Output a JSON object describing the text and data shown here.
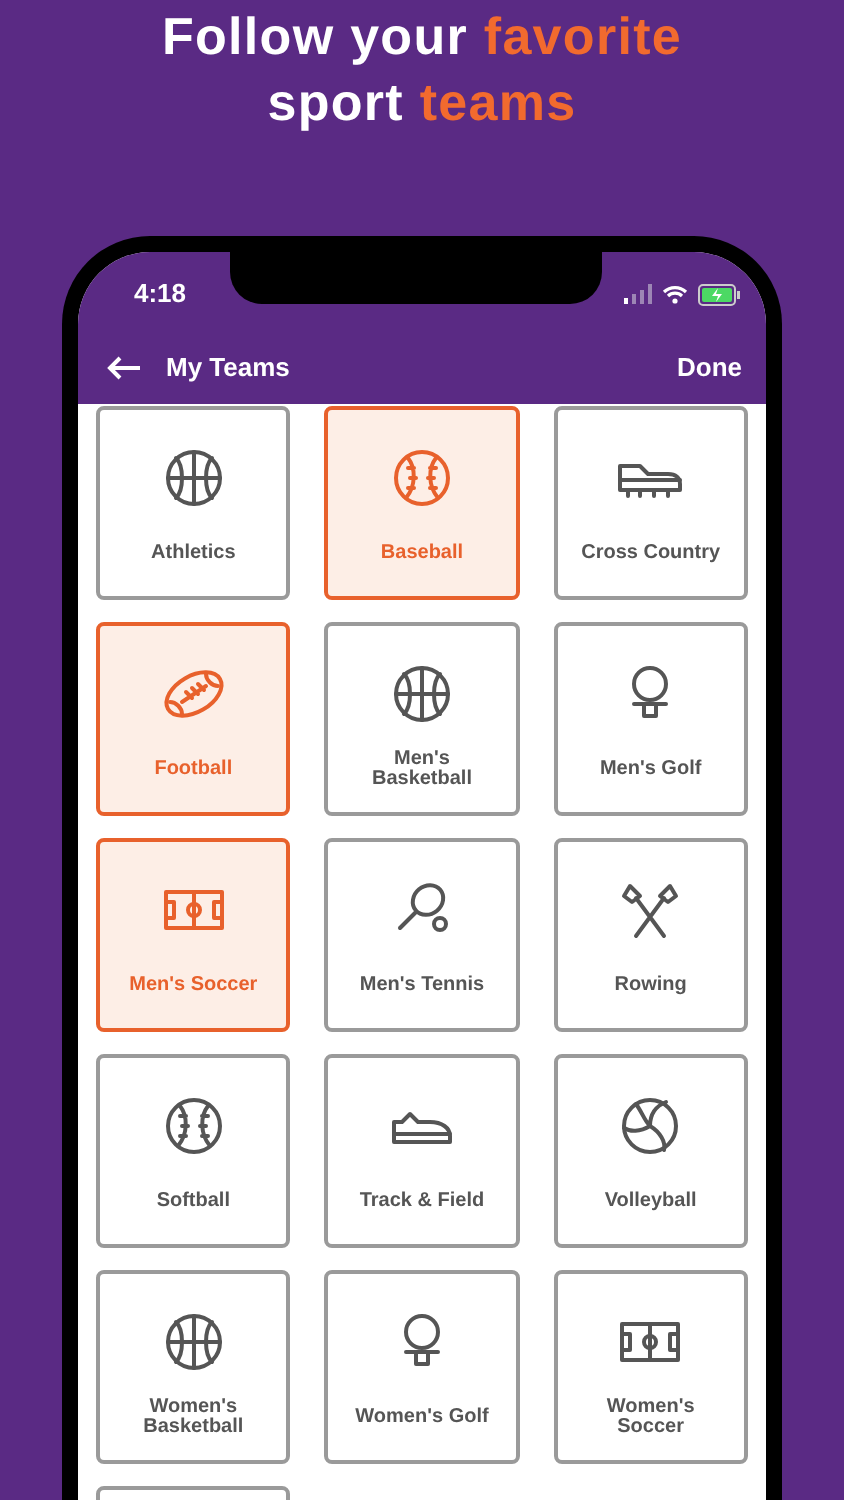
{
  "headline": [
    [
      {
        "text": "Follow your ",
        "accent": false
      },
      {
        "text": "favorite",
        "accent": true
      }
    ],
    [
      {
        "text": "sport ",
        "accent": false
      },
      {
        "text": "teams",
        "accent": true
      }
    ]
  ],
  "status_bar": {
    "time": "4:18"
  },
  "nav": {
    "title": "My Teams",
    "action": "Done"
  },
  "tiles": [
    {
      "label": "Athletics",
      "kind": "basketball",
      "selected": false
    },
    {
      "label": "Baseball",
      "kind": "baseball",
      "selected": true
    },
    {
      "label": "Cross Country",
      "kind": "cleat",
      "selected": false
    },
    {
      "label": "Football",
      "kind": "football",
      "selected": true
    },
    {
      "label": "Men's Basketball",
      "kind": "basketball",
      "selected": false
    },
    {
      "label": "Men's Golf",
      "kind": "golf",
      "selected": false
    },
    {
      "label": "Men's Soccer",
      "kind": "soccer",
      "selected": true
    },
    {
      "label": "Men's Tennis",
      "kind": "tennis",
      "selected": false
    },
    {
      "label": "Rowing",
      "kind": "rowing",
      "selected": false
    },
    {
      "label": "Softball",
      "kind": "baseball",
      "selected": false
    },
    {
      "label": "Track & Field",
      "kind": "shoe",
      "selected": false
    },
    {
      "label": "Volleyball",
      "kind": "volleyball",
      "selected": false
    },
    {
      "label": "Women's Basketball",
      "kind": "basketball",
      "selected": false
    },
    {
      "label": "Women's Golf",
      "kind": "golf",
      "selected": false
    },
    {
      "label": "Women's Soccer",
      "kind": "soccer",
      "selected": false
    },
    {
      "kind": "blank",
      "selected": false
    }
  ]
}
